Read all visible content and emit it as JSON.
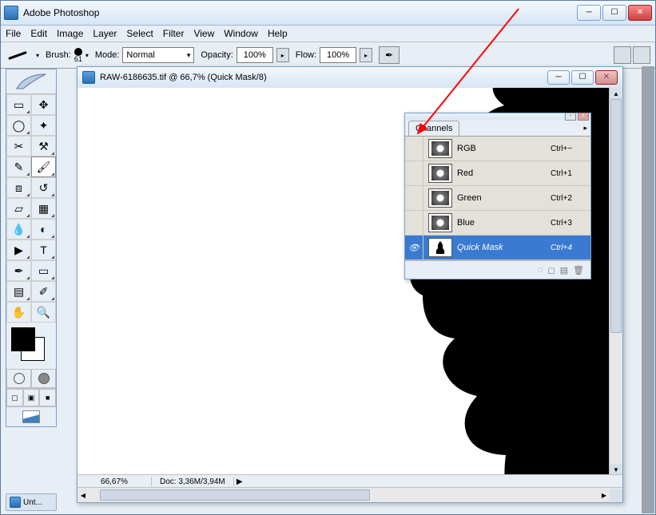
{
  "app": {
    "title": "Adobe Photoshop"
  },
  "menu": {
    "file": "File",
    "edit": "Edit",
    "image": "Image",
    "layer": "Layer",
    "select": "Select",
    "filter": "Filter",
    "view": "View",
    "window": "Window",
    "help": "Help"
  },
  "options": {
    "brush_label": "Brush:",
    "brush_size": "61",
    "mode_label": "Mode:",
    "mode_value": "Normal",
    "opacity_label": "Opacity:",
    "opacity_value": "100%",
    "flow_label": "Flow:",
    "flow_value": "100%"
  },
  "document": {
    "title": "RAW-6186635.tif @ 66,7% (Quick Mask/8)",
    "zoom": "66,67%",
    "docsize": "Doc: 3,36M/3,94M"
  },
  "channels": {
    "tab": "Channels",
    "items": [
      {
        "name": "RGB",
        "key": "Ctrl+~",
        "eye": false,
        "kind": "flower"
      },
      {
        "name": "Red",
        "key": "Ctrl+1",
        "eye": false,
        "kind": "flower"
      },
      {
        "name": "Green",
        "key": "Ctrl+2",
        "eye": false,
        "kind": "flower"
      },
      {
        "name": "Blue",
        "key": "Ctrl+3",
        "eye": false,
        "kind": "flower"
      },
      {
        "name": "Quick Mask",
        "key": "Ctrl+4",
        "eye": true,
        "kind": "mask",
        "selected": true
      }
    ]
  },
  "taskbar": {
    "doc_tab": "Unt..."
  }
}
